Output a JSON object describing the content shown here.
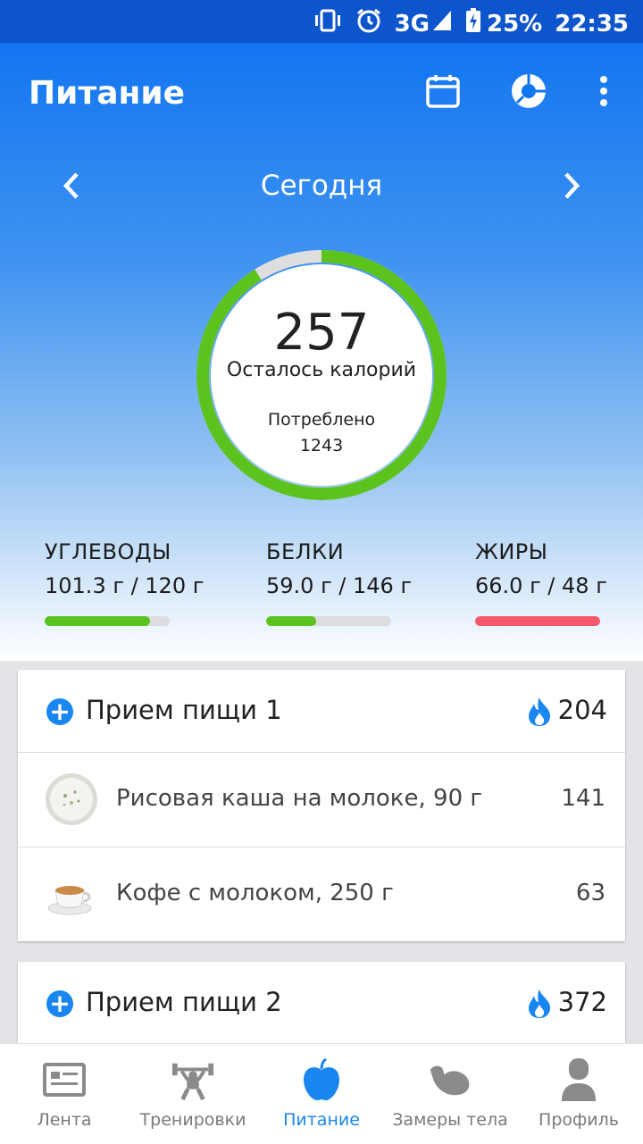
{
  "status_bar": {
    "network": "3G",
    "battery": "25%",
    "time": "22:35"
  },
  "app_bar": {
    "title": "Питание",
    "icons": [
      "calendar-icon",
      "pie-chart-icon",
      "more-vert-icon"
    ]
  },
  "date_nav": {
    "label": "Сегодня"
  },
  "calories": {
    "remaining": "257",
    "remaining_label": "Осталось калорий",
    "consumed_label": "Потреблено",
    "consumed": "1243",
    "progress": 0.91
  },
  "macros": [
    {
      "name": "УГЛЕВОДЫ",
      "value": "101.3 г / 120 г",
      "progress": 0.84,
      "color": "#5cc21d"
    },
    {
      "name": "БЕЛКИ",
      "value": "59.0 г / 146 г",
      "progress": 0.4,
      "color": "#5cc21d"
    },
    {
      "name": "ЖИРЫ",
      "value": "66.0 г / 48 г",
      "progress": 1.0,
      "color": "#f4566b"
    }
  ],
  "meals": [
    {
      "name": "Прием пищи 1",
      "calories": "204",
      "items": [
        {
          "name": "Рисовая каша на молоке, 90 г",
          "calories": "141"
        },
        {
          "name": "Кофе с молоком, 250 г",
          "calories": "63"
        }
      ]
    },
    {
      "name": "Прием пищи 2",
      "calories": "372",
      "items": []
    }
  ],
  "bottom_nav": [
    {
      "label": "Лента",
      "icon": "feed-icon",
      "active": false
    },
    {
      "label": "Тренировки",
      "icon": "workout-icon",
      "active": false
    },
    {
      "label": "Питание",
      "icon": "apple-icon",
      "active": true
    },
    {
      "label": "Замеры тела",
      "icon": "muscle-arm-icon",
      "active": false
    },
    {
      "label": "Профиль",
      "icon": "profile-icon",
      "active": false
    }
  ],
  "colors": {
    "accent": "#1a86f0",
    "header": "#1275f0",
    "progress_ok": "#5cc21d",
    "progress_over": "#f4566b"
  }
}
